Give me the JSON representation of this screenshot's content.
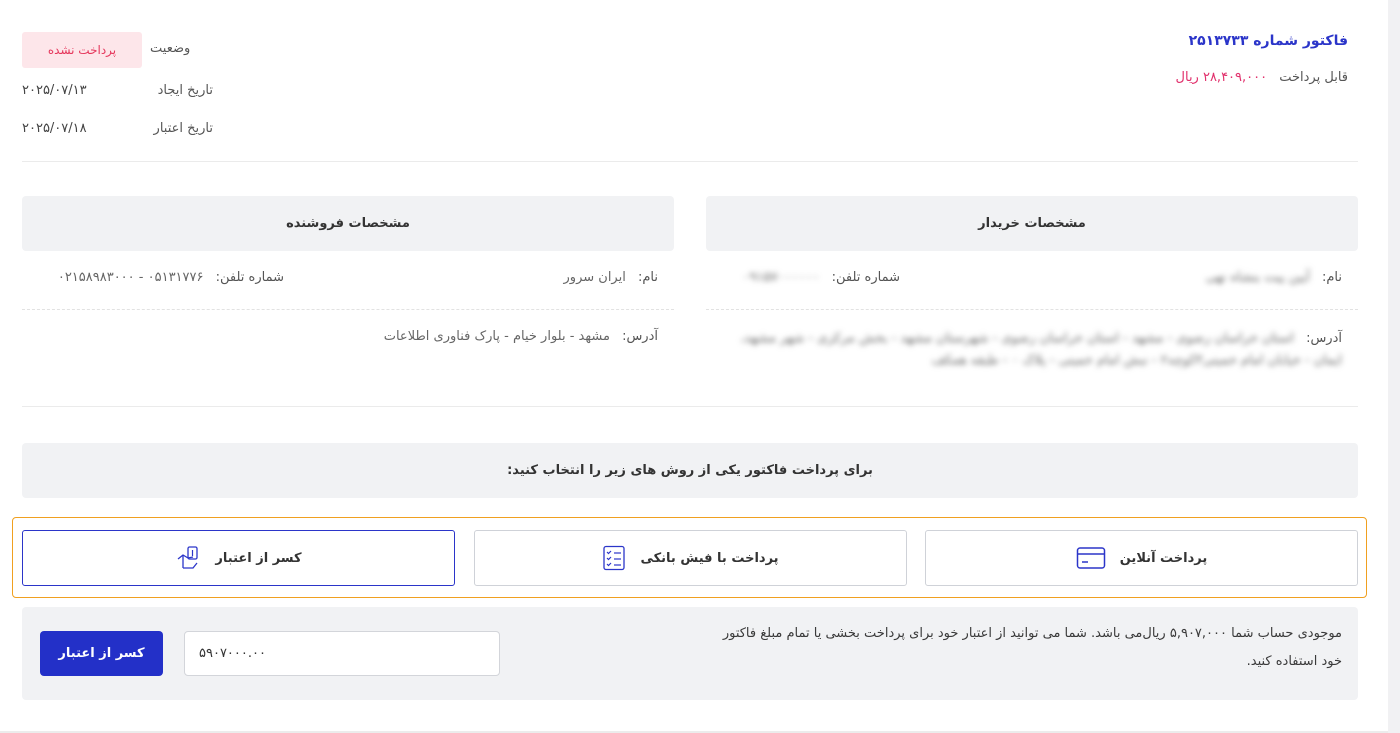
{
  "invoice": {
    "title": "فاکتور شماره ۲۵۱۳۷۳۳",
    "payable_label": "قابل پرداخت",
    "payable_amount": "۲۸,۴۰۹,۰۰۰ ریال"
  },
  "status": {
    "label": "وضعیت",
    "badge": "پرداخت نشده"
  },
  "dates": {
    "created_label": "تاریخ ایجاد",
    "created_value": "۲۰۲۵/۰۷/۱۳",
    "expiry_label": "تاریخ اعتبار",
    "expiry_value": "۲۰۲۵/۰۷/۱۸"
  },
  "buyer": {
    "heading": "مشخصات خریدار",
    "name_label": "نام:",
    "name_value": "آیین پیت بنشاه نهی",
    "phone_label": "شماره تلفن:",
    "phone_value": "۰۹۱۵۷۰۰۰۰۰۰",
    "address_label": "آدرس:",
    "address_value": "استان خراسان رضوی - مشهد - استان خراسان رضوی - شهرستان مشهد - بخش مرکزی - شهر مشهد، ایمان - خیابان امام خمینی۳کوچه۲ - نبش امام خمینی - پلاک ۰ - طبقه همکف"
  },
  "seller": {
    "heading": "مشخصات فروشنده",
    "name_label": "نام:",
    "name_value": "ایران سرور",
    "phone_label": "شماره تلفن:",
    "phone_value": "۰۵۱۳۱۷۷۶ - ۰۲۱۵۸۹۸۳۰۰۰",
    "address_label": "آدرس:",
    "address_value": "مشهد - بلوار خیام - پارک فناوری اطلاعات"
  },
  "instruction": "برای پرداخت فاکتور یکی از روش های زیر را انتخاب کنید:",
  "methods": {
    "online": "پرداخت آنلاین",
    "receipt": "پرداخت با فیش بانکی",
    "credit": "کسر از اعتبار"
  },
  "credit_panel": {
    "text": "موجودی حساب شما ۵,۹۰۷,۰۰۰ ریال‌می باشد. شما می توانید از اعتبار خود برای پرداخت بخشی یا تمام مبلغ فاکتور خود استفاده کنید.",
    "input_value": "۵۹۰۷۰۰۰.۰۰",
    "button": "کسر از اعتبار"
  },
  "colors": {
    "accent": "#2330c8",
    "unpaid_text": "#e5365b",
    "unpaid_bg": "#fde6ea",
    "highlight_frame": "#f0a020",
    "panel_bg": "#f1f2f4"
  }
}
